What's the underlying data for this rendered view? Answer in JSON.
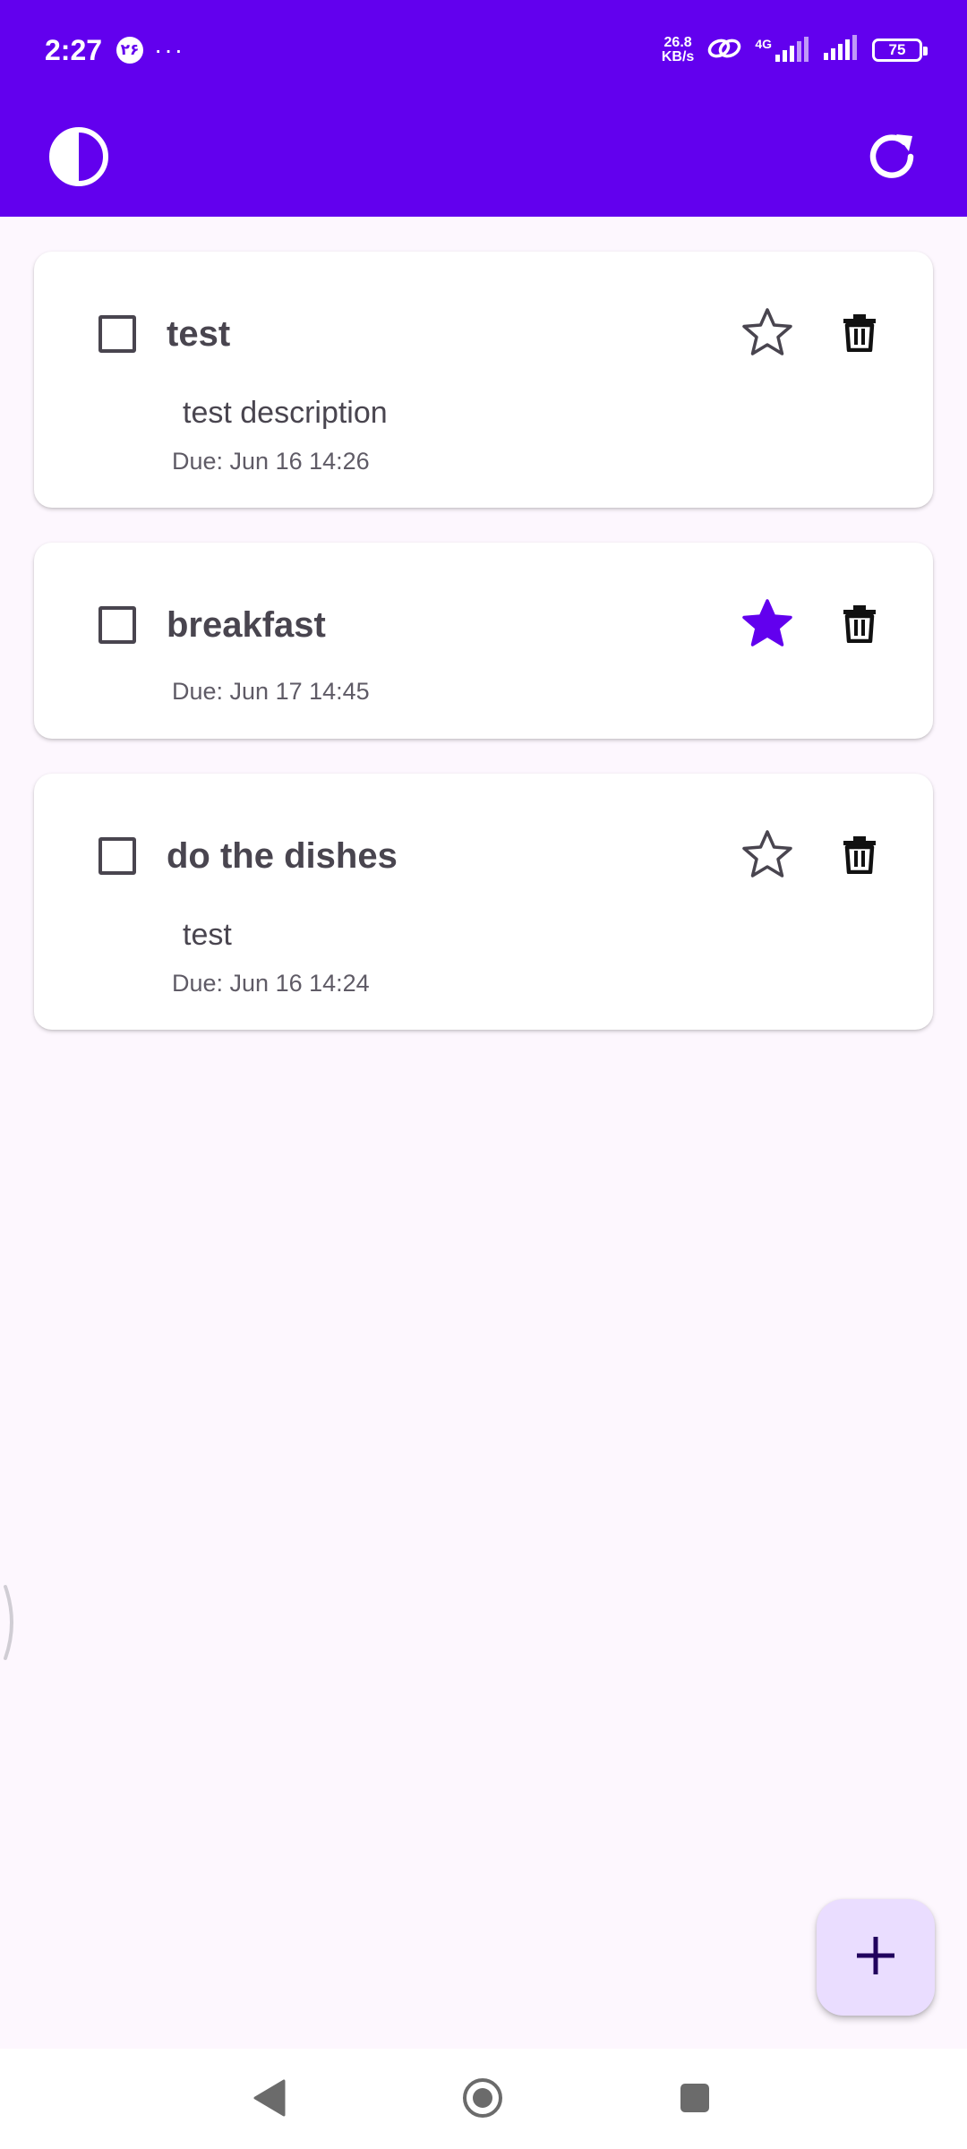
{
  "status_bar": {
    "time": "2:27",
    "badge": "۲۶",
    "more": "···",
    "net_speed_value": "26.8",
    "net_speed_unit": "KB/s",
    "network_type": "4G",
    "battery": "75"
  },
  "app_bar": {
    "theme_icon": "contrast-icon",
    "refresh_icon": "refresh-icon",
    "background_color": "#6200EE"
  },
  "tasks": [
    {
      "title": "test",
      "description": "test description",
      "due": "Due: Jun 16 14:26",
      "starred": false,
      "completed": false
    },
    {
      "title": "breakfast",
      "description": "",
      "due": "Due: Jun 17 14:45",
      "starred": true,
      "completed": false
    },
    {
      "title": "do the dishes",
      "description": "test",
      "due": "Due: Jun 16 14:24",
      "starred": false,
      "completed": false
    }
  ],
  "fab": {
    "icon": "plus-icon",
    "color": "#EADDFF"
  },
  "colors": {
    "accent": "#6200EE",
    "star_filled": "#6200EE",
    "text": "#49454F"
  }
}
